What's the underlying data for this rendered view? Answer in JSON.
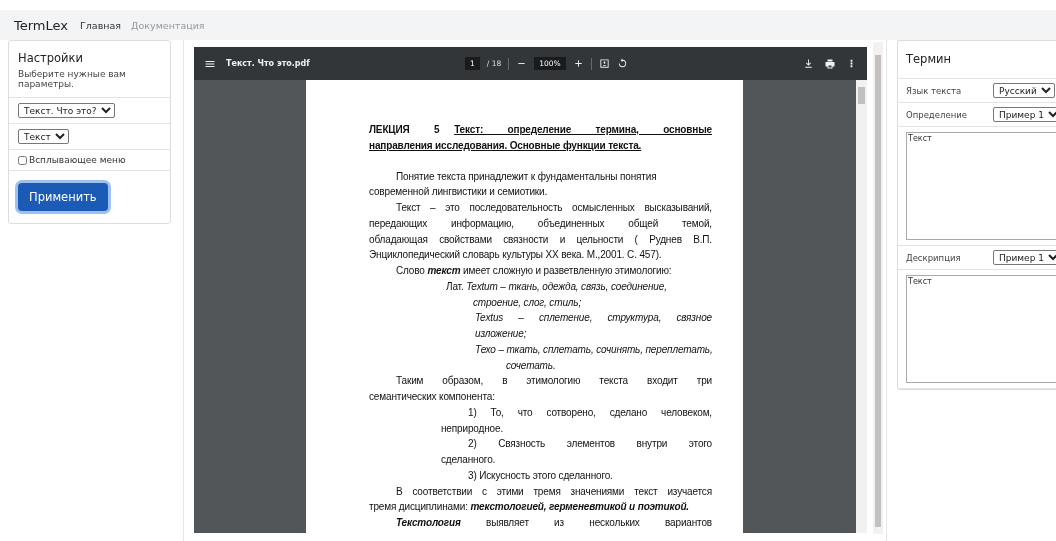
{
  "navbar": {
    "brand": "TermLex",
    "links": [
      {
        "label": "Главная",
        "selected": true
      },
      {
        "label": "Документация",
        "selected": false
      }
    ]
  },
  "settings": {
    "title": "Настройки",
    "subtitle": "Выберите нужные вам параметры.",
    "document_select": "Текст. Что это?",
    "type_select": "Текст",
    "popup_menu": {
      "label": "Всплывающее меню",
      "checked": false
    },
    "apply_button": "Применить"
  },
  "pdf_viewer": {
    "file_name": "Текст. Что это.pdf",
    "page": "1",
    "page_count": "/ 18",
    "zoom": "100%",
    "lines": [
      {
        "kind": "heading",
        "lead": "ЛЕКЦИЯ 5",
        "text": "Текст: определение термина, основные"
      },
      {
        "kind": "heading-end",
        "text": "направления исследования. Основные функции текста."
      },
      {
        "kind": "para-open",
        "text": "Понятие текста принадлежит к фундаментальны понятия"
      },
      {
        "kind": "body-end",
        "text": "современной лингвистики и семиотики."
      },
      {
        "kind": "para",
        "text": "Текст – это последовательность осмысленных высказываний,"
      },
      {
        "kind": "body",
        "text": "передающих информацию, объединенных общей темой,"
      },
      {
        "kind": "body",
        "text": "обладающая свойствами связности и цельности ( Руднев В.П."
      },
      {
        "kind": "body-end",
        "text": "Энциклопедический словарь культуры XX века. М.,2001. С. 457)."
      },
      {
        "kind": "para-open",
        "text": "Слово **текст** имеет сложную и разветвленную этимологию:"
      },
      {
        "kind": "lat",
        "text": "Лат. *Textum – ткань, одежда, связь, соединение,*"
      },
      {
        "kind": "lat-cont",
        "text": "*строение, слог, стиль;*"
      },
      {
        "kind": "etym",
        "text": "*Textus – сплетение, структура, связное*"
      },
      {
        "kind": "etym-end",
        "text": "*изложение;*"
      },
      {
        "kind": "etym",
        "text": "*Техо – ткать, сплетать, сочинять, переплетать,*"
      },
      {
        "kind": "etym-tail",
        "text": "*сочетать.*"
      },
      {
        "kind": "para",
        "text": "Таким образом, в этимологию текста входит три"
      },
      {
        "kind": "body-end",
        "text": "семантических компонента:"
      },
      {
        "kind": "list",
        "text": "1) То, что сотворено, сделано человеком,"
      },
      {
        "kind": "list-end",
        "text": "неприродное."
      },
      {
        "kind": "list",
        "text": "2) Связность элементов внутри этого"
      },
      {
        "kind": "list-end",
        "text": "сделанного."
      },
      {
        "kind": "list-open",
        "text": "3) Искусность этого сделанного."
      },
      {
        "kind": "para",
        "text": "В соответствии с этими тремя значениями текст изучается"
      },
      {
        "kind": "body-end",
        "text": "тремя дисциплинами: **текстологией, герменевтикой и поэтикой.**"
      },
      {
        "kind": "para",
        "text": "**Текстология** выявляет из нескольких вариантов"
      }
    ]
  },
  "term": {
    "title": "Термин",
    "fields": [
      {
        "kind": "select",
        "label": "Язык текста",
        "value": "Русский"
      },
      {
        "kind": "select",
        "label": "Определение",
        "value": "Пример 1"
      },
      {
        "kind": "textarea",
        "value": "Текст"
      },
      {
        "kind": "select",
        "label": "Дескрипция",
        "value": "Пример 1"
      },
      {
        "kind": "textarea",
        "value": "Текст"
      }
    ]
  }
}
